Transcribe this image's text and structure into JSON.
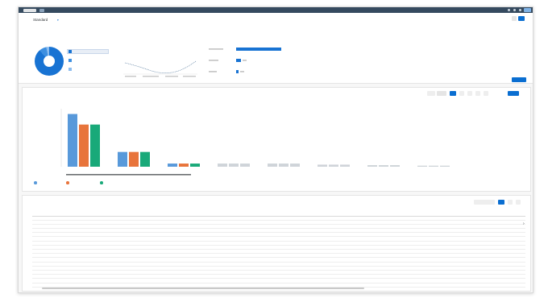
{
  "shell": {
    "title": "",
    "icons": [
      "search-icon",
      "bell-icon",
      "help-icon"
    ]
  },
  "header": {
    "variant": "Standard",
    "variant_chevron": "▾",
    "go_label": ""
  },
  "kpis": [
    {
      "title": "",
      "value": ""
    },
    {
      "title": "",
      "value": ""
    },
    {
      "title": "",
      "value": ""
    }
  ],
  "donut_legend": [
    {
      "label": "",
      "value": "",
      "color": "#1873d3"
    },
    {
      "label": "",
      "value": "",
      "color": "#3d8fe0"
    },
    {
      "label": "",
      "value": "",
      "color": "#8cbcee"
    }
  ],
  "chart_panel": {
    "title": "",
    "subtitle": ""
  },
  "chart_data": {
    "type": "bar",
    "categories": [
      "",
      "",
      "",
      "",
      "",
      "",
      "",
      ""
    ],
    "series": [
      {
        "values": [
          100,
          28,
          6,
          6,
          6,
          4,
          3,
          2
        ],
        "color": "#5899da"
      },
      {
        "values": [
          80,
          28,
          6,
          6,
          6,
          4,
          3,
          2
        ],
        "color": "#e8743b"
      },
      {
        "values": [
          80,
          28,
          6,
          6,
          6,
          4,
          3,
          2
        ],
        "color": "#19a979"
      }
    ],
    "title": "",
    "xlabel": "",
    "ylabel": "",
    "ylim": [
      0,
      110
    ],
    "yticks": [
      "",
      "",
      "",
      "",
      "",
      ""
    ],
    "grid": false,
    "legend": "bottom-left"
  },
  "legend": [
    {
      "label": "",
      "color": "#5899da"
    },
    {
      "label": "",
      "color": "#e8743b"
    },
    {
      "label": "",
      "color": "#19a979"
    }
  ],
  "table": {
    "title": "",
    "columns": [
      "",
      "",
      "",
      "",
      "",
      "",
      "",
      ""
    ],
    "rows": [
      [
        "",
        "",
        "",
        "",
        "",
        "",
        "",
        ""
      ],
      [
        "",
        "",
        "",
        "",
        "",
        "",
        "",
        ""
      ],
      [
        "",
        "",
        "",
        "",
        "",
        "",
        "",
        ""
      ],
      [
        "",
        "",
        "",
        "",
        "",
        "",
        "",
        ""
      ],
      [
        "",
        "",
        "",
        "",
        "",
        "",
        "",
        ""
      ],
      [
        "",
        "",
        "",
        "",
        "",
        "",
        "",
        ""
      ],
      [
        "",
        "",
        "",
        "",
        "",
        "",
        "",
        ""
      ],
      [
        "",
        "",
        "",
        "",
        "",
        "",
        "",
        ""
      ],
      [
        "",
        "",
        "",
        "",
        "",
        "",
        "",
        ""
      ],
      [
        "",
        "",
        "",
        "",
        "",
        "",
        "",
        ""
      ],
      [
        "",
        "",
        "",
        "",
        "",
        "",
        "",
        ""
      ],
      [
        "",
        "",
        "",
        "",
        "",
        "",
        "",
        ""
      ],
      [
        "",
        "",
        "",
        "",
        "",
        "",
        "",
        ""
      ],
      [
        "",
        "",
        "",
        "",
        "",
        "",
        "",
        ""
      ],
      [
        "",
        "",
        "",
        "",
        "",
        "",
        "",
        ""
      ],
      [
        "",
        "",
        "",
        "",
        "",
        "",
        "",
        ""
      ],
      [
        "",
        "",
        "",
        "",
        "",
        "",
        "",
        ""
      ]
    ]
  }
}
